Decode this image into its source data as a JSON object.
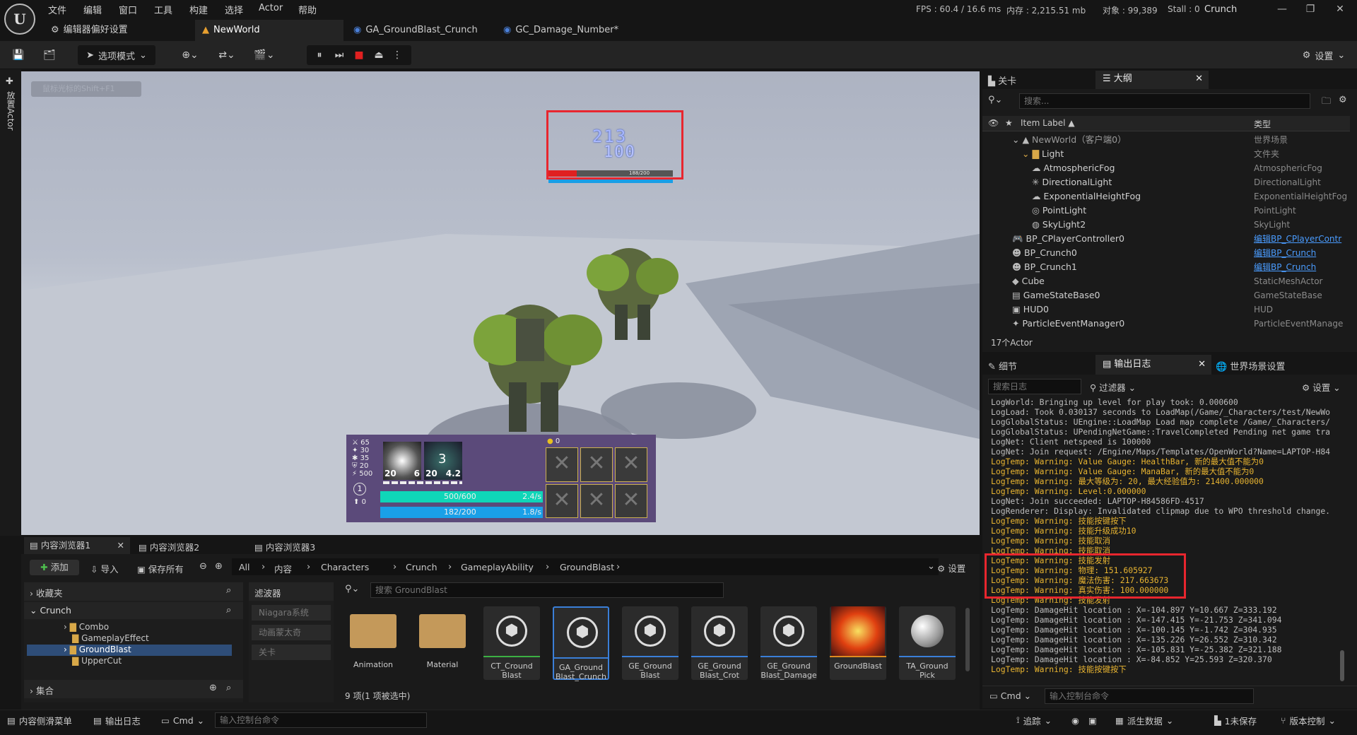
{
  "menu": [
    "文件",
    "编辑",
    "窗口",
    "工具",
    "构建",
    "选择",
    "Actor",
    "帮助"
  ],
  "stats": {
    "fps": "FPS : 60.4 / 16.6 ms",
    "mem": "内存 : 2,215.51 mb",
    "objects": "对象 : 99,389",
    "stall": "Stall : 0",
    "project": "Crunch"
  },
  "tabs": [
    "编辑器偏好设置",
    "NewWorld",
    "GA_GroundBlast_Crunch",
    "GC_Damage_Number*"
  ],
  "toolbar": {
    "mode": "选项模式",
    "settings": "设置"
  },
  "leftstrip": {
    "label": "放置Actor"
  },
  "viewport": {
    "hint": "鼠标光标的Shift+F1",
    "damage_top": "213",
    "damage_bottom": "100",
    "enemy_hp": "188/200",
    "hud": {
      "stats": [
        "65",
        "30",
        "35",
        "20",
        "500",
        "0"
      ],
      "level": "1",
      "skill1_level": "20",
      "skill1_cd": "6",
      "skill2_level": "20",
      "skill2_count": "3",
      "skill2_cd": "4.2",
      "coins": "0",
      "hp": "500/600",
      "hp_regen": "2.4/s",
      "mp": "182/200",
      "mp_regen": "1.8/s"
    }
  },
  "outliner": {
    "tab1": "关卡",
    "tab2": "大纲",
    "search_placeholder": "搜索...",
    "col_label": "Item Label ▲",
    "col_type": "类型",
    "rows": [
      {
        "label": "NewWorld（客户端0）",
        "type": "世界场景"
      },
      {
        "label": "Light",
        "type": "文件夹"
      },
      {
        "label": "AtmosphericFog",
        "type": "AtmosphericFog"
      },
      {
        "label": "DirectionalLight",
        "type": "DirectionalLight"
      },
      {
        "label": "ExponentialHeightFog",
        "type": "ExponentialHeightFog"
      },
      {
        "label": "PointLight",
        "type": "PointLight"
      },
      {
        "label": "SkyLight2",
        "type": "SkyLight"
      },
      {
        "label": "BP_CPlayerController0",
        "type": "编辑BP_CPlayerContr"
      },
      {
        "label": "BP_Crunch0",
        "type": "编辑BP_Crunch"
      },
      {
        "label": "BP_Crunch1",
        "type": "编辑BP_Crunch"
      },
      {
        "label": "Cube",
        "type": "StaticMeshActor"
      },
      {
        "label": "GameStateBase0",
        "type": "GameStateBase"
      },
      {
        "label": "HUD0",
        "type": "HUD"
      },
      {
        "label": "ParticleEventManager0",
        "type": "ParticleEventManage"
      }
    ],
    "count": "17个Actor"
  },
  "logpanel": {
    "tab_details": "细节",
    "tab_log": "输出日志",
    "tab_world": "世界场景设置",
    "search_placeholder": "搜索日志",
    "filter": "过滤器",
    "settings": "设置",
    "cmd": "Cmd",
    "cmd_placeholder": "输入控制台命令",
    "lines": [
      {
        "t": "LogWorld: Bringing up level for play took: 0.000600",
        "w": false
      },
      {
        "t": "LogLoad: Took 0.030137 seconds to LoadMap(/Game/_Characters/test/NewWo",
        "w": false
      },
      {
        "t": "LogGlobalStatus: UEngine::LoadMap Load map complete /Game/_Characters/",
        "w": false
      },
      {
        "t": "LogGlobalStatus: UPendingNetGame::TravelCompleted Pending net game tra",
        "w": false
      },
      {
        "t": "LogNet: Client netspeed is 100000",
        "w": false
      },
      {
        "t": "LogNet: Join request: /Engine/Maps/Templates/OpenWorld?Name=LAPTOP-H84",
        "w": false
      },
      {
        "t": "LogTemp: Warning: Value Gauge: HealthBar, 新的最大值不能为0",
        "w": true
      },
      {
        "t": "LogTemp: Warning: Value Gauge: ManaBar, 新的最大值不能为0",
        "w": true
      },
      {
        "t": "LogTemp: Warning: 最大等级为: 20, 最大经验值为: 21400.000000",
        "w": true
      },
      {
        "t": "LogTemp: Warning: Level:0.000000",
        "w": true
      },
      {
        "t": "LogNet: Join succeeded: LAPTOP-H84586FD-4517",
        "w": false
      },
      {
        "t": "LogRenderer: Display: Invalidated clipmap due to WPO threshold change.",
        "w": false
      },
      {
        "t": "LogTemp: Warning: 技能按键按下",
        "w": true
      },
      {
        "t": "LogTemp: Warning: 技能升级成功10",
        "w": true
      },
      {
        "t": "LogTemp: Warning: 技能取消",
        "w": true
      },
      {
        "t": "LogTemp: Warning: 技能取消",
        "w": true
      },
      {
        "t": "LogTemp: Warning: 技能发射",
        "w": true
      },
      {
        "t": "LogTemp: Warning: 物理: 151.605927",
        "w": true
      },
      {
        "t": "LogTemp: Warning: 魔法伤害: 217.663673",
        "w": true
      },
      {
        "t": "LogTemp: Warning: 真实伤害: 100.000000",
        "w": true
      },
      {
        "t": "LogTemp: Warning: 技能发射",
        "w": true
      },
      {
        "t": "LogTemp: DamageHit location : X=-104.897 Y=10.667 Z=333.192",
        "w": false
      },
      {
        "t": "LogTemp: DamageHit location : X=-147.415 Y=-21.753 Z=341.094",
        "w": false
      },
      {
        "t": "LogTemp: DamageHit location : X=-100.145 Y=-1.742 Z=304.935",
        "w": false
      },
      {
        "t": "LogTemp: DamageHit location : X=-135.226 Y=26.552 Z=310.342",
        "w": false
      },
      {
        "t": "LogTemp: DamageHit location : X=-105.831 Y=-25.382 Z=321.188",
        "w": false
      },
      {
        "t": "LogTemp: DamageHit location : X=-84.852 Y=25.593 Z=320.370",
        "w": false
      },
      {
        "t": "LogTemp: Warning: 技能按键按下",
        "w": true
      }
    ]
  },
  "content": {
    "tabs": [
      "内容浏览器1",
      "内容浏览器2",
      "内容浏览器3"
    ],
    "add": "添加",
    "import": "导入",
    "saveall": "保存所有",
    "settings": "设置",
    "path": [
      "All",
      "内容",
      "Characters",
      "Crunch",
      "GameplayAbility",
      "GroundBlast"
    ],
    "favorites": "收藏夹",
    "root": "Crunch",
    "tree": [
      "Combo",
      "GameplayEffect",
      "GroundBlast",
      "UpperCut"
    ],
    "collections": "集合",
    "filters_title": "滤波器",
    "filters": [
      "Niagara系统",
      "动画蒙太奇",
      "关卡"
    ],
    "search_placeholder": "搜索 GroundBlast",
    "items": [
      {
        "label": "Animation",
        "kind": "folder"
      },
      {
        "label": "Material",
        "kind": "folder"
      },
      {
        "label": "CT_Cround Blast",
        "kind": "asset"
      },
      {
        "label": "GA_Ground Blast_Crunch",
        "kind": "asset"
      },
      {
        "label": "GE_Ground Blast",
        "kind": "asset"
      },
      {
        "label": "GE_Ground Blast_Crot",
        "kind": "asset"
      },
      {
        "label": "GE_Ground Blast_Damage",
        "kind": "asset"
      },
      {
        "label": "GroundBlast",
        "kind": "fx"
      },
      {
        "label": "TA_Ground Pick",
        "kind": "sphere"
      }
    ],
    "status": "9 项(1 项被选中)"
  },
  "bottombar": {
    "drawer": "内容侧滑菜单",
    "log": "输出日志",
    "cmd": "Cmd",
    "cmd_placeholder": "输入控制台命令",
    "trace": "追踪",
    "derived": "派生数据",
    "unsaved": "1未保存",
    "source": "版本控制"
  }
}
